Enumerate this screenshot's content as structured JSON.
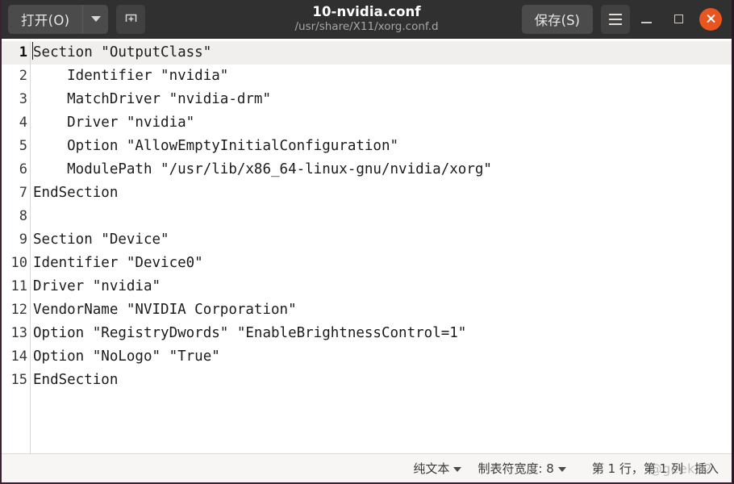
{
  "window": {
    "accent_close": "#e8551e",
    "titlebar_bg": "#303030"
  },
  "titlebar": {
    "open_label": "打开(O)",
    "open_dropdown_icon": "chevron-down-icon",
    "new_document_icon": "new-document-icon",
    "title": "10-nvidia.conf",
    "subtitle": "/usr/share/X11/xorg.conf.d",
    "save_label": "保存(S)",
    "menu_icon": "hamburger-menu-icon",
    "minimize_icon": "minimize-icon",
    "maximize_icon": "maximize-icon",
    "close_icon": "close-icon"
  },
  "editor": {
    "current_line": 1,
    "lines": [
      {
        "n": "1",
        "text": "Section \"OutputClass\""
      },
      {
        "n": "2",
        "text": "    Identifier \"nvidia\""
      },
      {
        "n": "3",
        "text": "    MatchDriver \"nvidia-drm\""
      },
      {
        "n": "4",
        "text": "    Driver \"nvidia\""
      },
      {
        "n": "5",
        "text": "    Option \"AllowEmptyInitialConfiguration\""
      },
      {
        "n": "6",
        "text": "    ModulePath \"/usr/lib/x86_64-linux-gnu/nvidia/xorg\""
      },
      {
        "n": "7",
        "text": "EndSection"
      },
      {
        "n": "8",
        "text": ""
      },
      {
        "n": "9",
        "text": "Section \"Device\""
      },
      {
        "n": "10",
        "text": "Identifier \"Device0\""
      },
      {
        "n": "11",
        "text": "Driver \"nvidia\""
      },
      {
        "n": "12",
        "text": "VendorName \"NVIDIA Corporation\""
      },
      {
        "n": "13",
        "text": "Option \"RegistryDwords\" \"EnableBrightnessControl=1\""
      },
      {
        "n": "14",
        "text": "Option \"NoLogo\" \"True\""
      },
      {
        "n": "15",
        "text": "EndSection"
      }
    ]
  },
  "statusbar": {
    "language": "纯文本",
    "tab_width": "制表符宽度: 8",
    "position": "第 1 行，第 1 列",
    "insert_mode": "插入",
    "watermark": "@geek12"
  }
}
